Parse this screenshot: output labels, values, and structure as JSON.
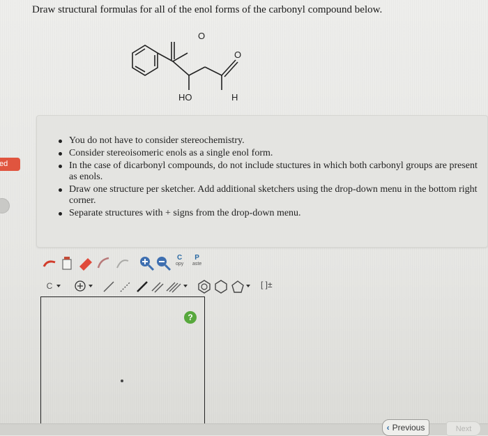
{
  "question": {
    "title": "Draw structural formulas for all of the enol forms of the carbonyl compound below."
  },
  "molecule": {
    "oxygen_top": "O",
    "oxygen_right": "O",
    "hydroxyl_label": "HO",
    "hydrogen_label": "H"
  },
  "side_tab": {
    "label": "ed"
  },
  "instructions": {
    "items": [
      "You do not have to consider stereochemistry.",
      "Consider stereoisomeric enols as a single enol form.",
      "In the case of dicarbonyl compounds, do not include stuctures in which both carbonyl groups are present as enols.",
      "Draw one structure per sketcher. Add additional sketchers using the drop-down menu in the bottom right corner.",
      "Separate structures with + signs from the drop-down menu."
    ]
  },
  "toolbar": {
    "copy_label": "C",
    "copy_sub": "opy",
    "paste_label": "P",
    "paste_sub": "aste",
    "element_label": "C",
    "charge_label": "[ ]±"
  },
  "sketcher": {
    "help_label": "?"
  },
  "nav": {
    "previous_label": "Previous",
    "next_label": "Next"
  },
  "colors": {
    "side_tab": "#e0553f",
    "help": "#57a83c",
    "accent": "#2b6aa3"
  }
}
